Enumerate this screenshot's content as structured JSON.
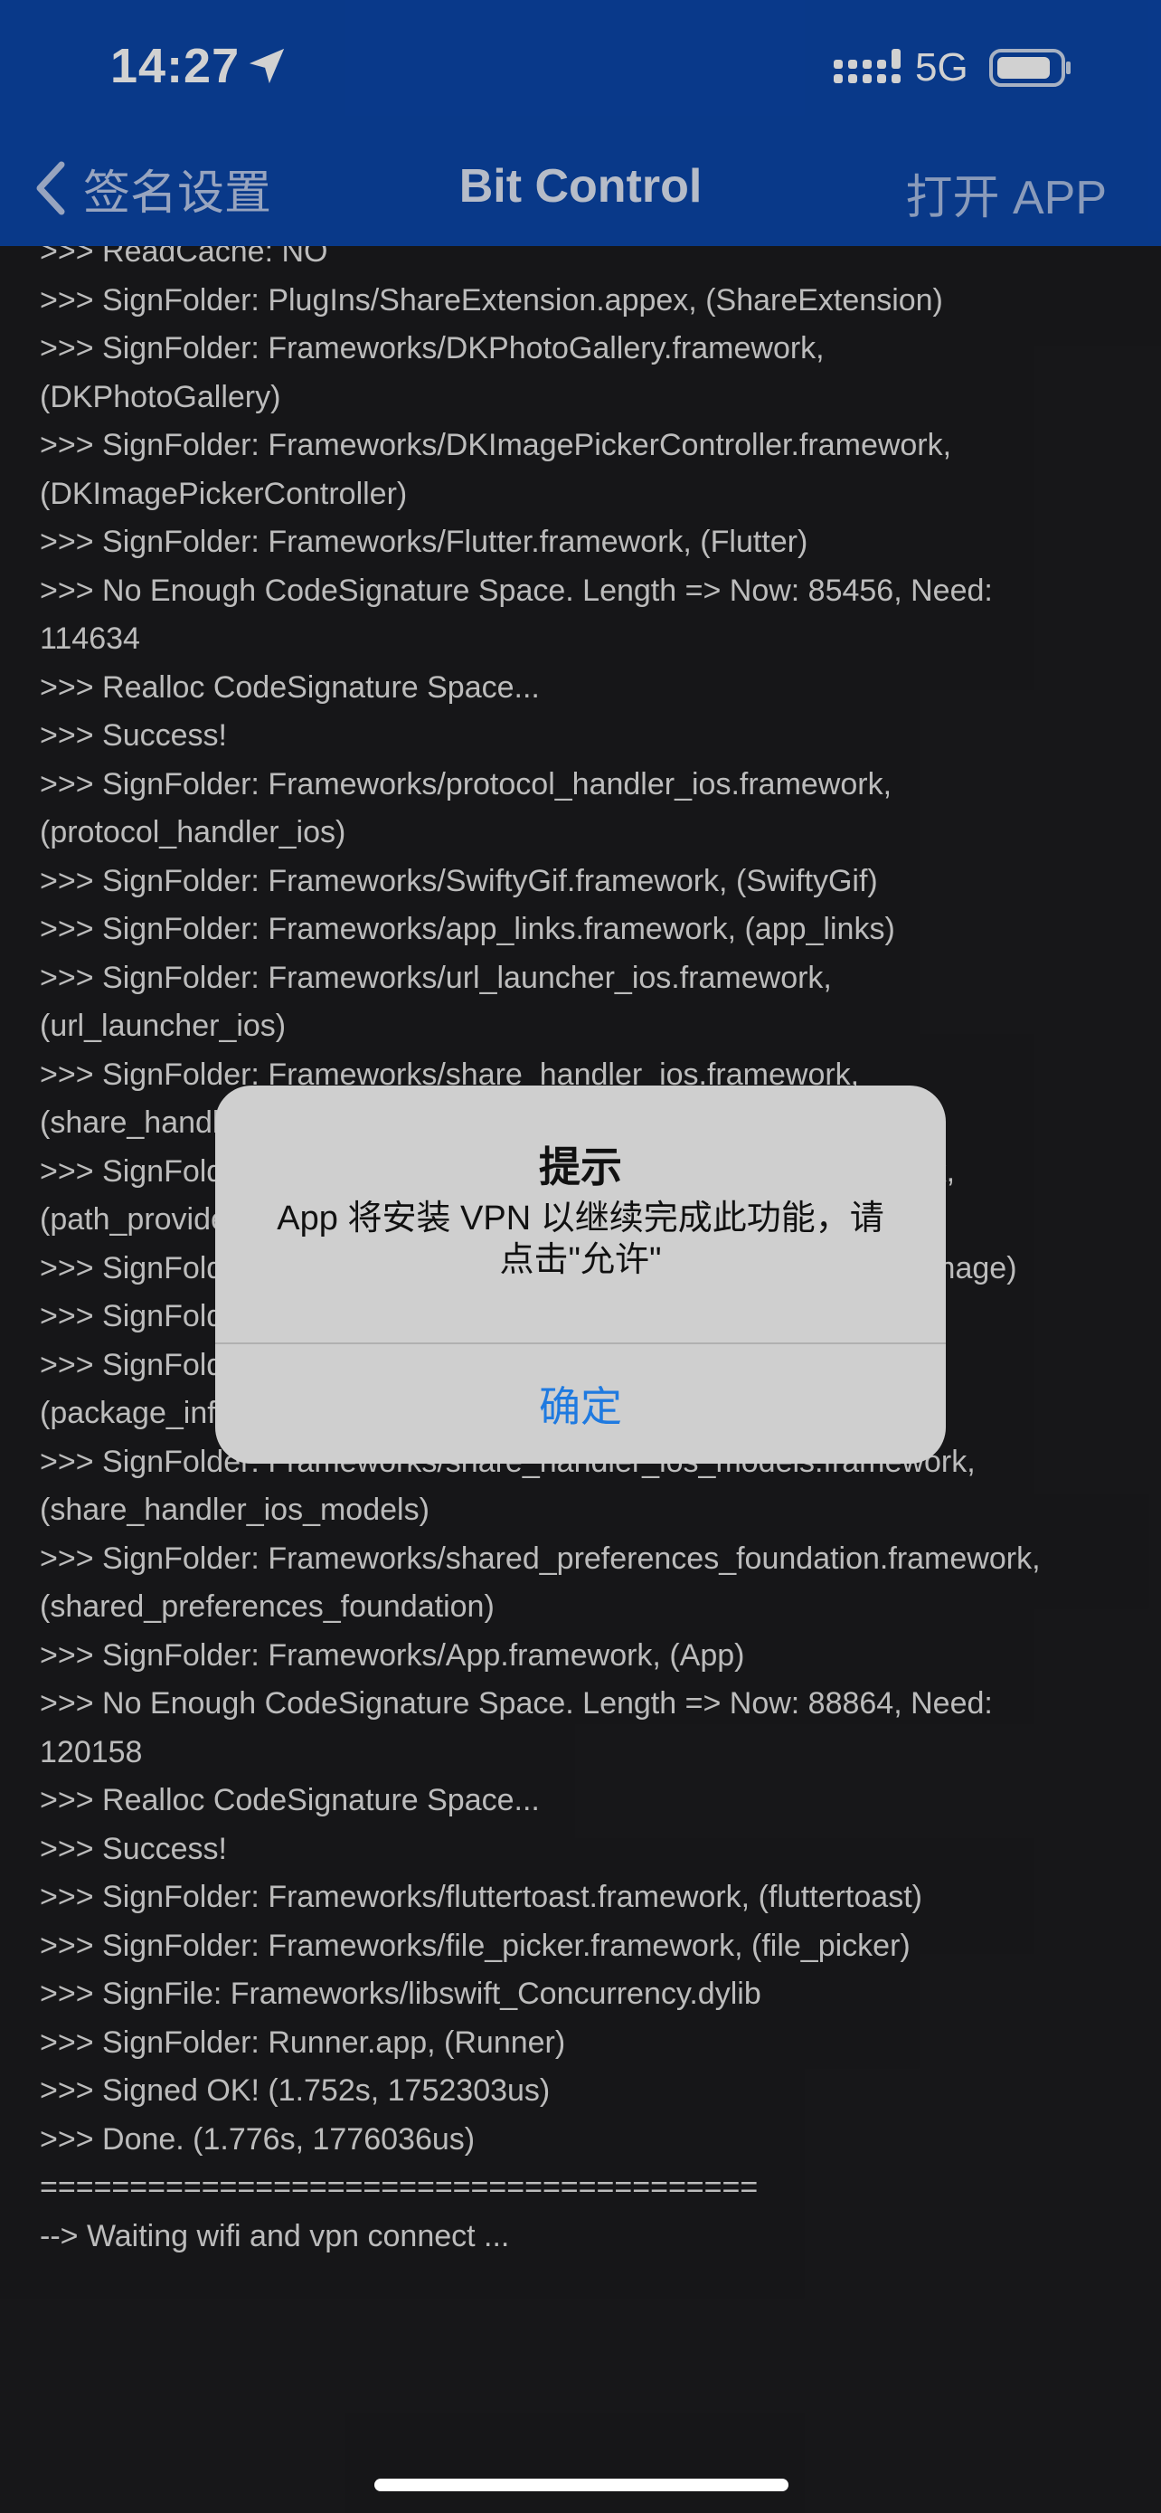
{
  "status_bar": {
    "time": "14:27",
    "network": "5G",
    "icons": [
      "location-arrow-icon",
      "signal-bars-icon",
      "battery-icon"
    ]
  },
  "nav": {
    "back_label": "签名设置",
    "title": "Bit Control",
    "action_label": "打开 APP"
  },
  "log_lines": [
    ">>> ReadCache:      NO",
    ">>> SignFolder: PlugIns/ShareExtension.appex, (ShareExtension)",
    ">>> SignFolder: Frameworks/DKPhotoGallery.framework,",
    "(DKPhotoGallery)",
    ">>> SignFolder: Frameworks/DKImagePickerController.framework,",
    "(DKImagePickerController)",
    ">>> SignFolder: Frameworks/Flutter.framework, (Flutter)",
    ">>> No Enough CodeSignature Space. Length => Now: 85456, Need:",
    "114634",
    ">>> Realloc CodeSignature Space...",
    ">>> Success!",
    ">>> SignFolder: Frameworks/protocol_handler_ios.framework,",
    "(protocol_handler_ios)",
    ">>> SignFolder: Frameworks/SwiftyGif.framework, (SwiftyGif)",
    ">>> SignFolder: Frameworks/app_links.framework, (app_links)",
    ">>> SignFolder: Frameworks/url_launcher_ios.framework,",
    "(url_launcher_ios)",
    ">>> SignFolder: Frameworks/share_handler_ios.framework,",
    "(share_handler_ios)",
    ">>> SignFolder: Frameworks/path_provider_foundation.framework,",
    "(path_provider_foundation)",
    ">>> SignFolder: Frameworks/SDWebImage.framework, (SDWebImage)",
    ">>> SignFolder: Frameworks/Toast.framework, (Toast_ios)",
    ">>> SignFolder: Frameworks/package_info_plus.framework,",
    "(package_info_plus)",
    ">>> SignFolder: Frameworks/share_handler_ios_models.framework,",
    "(share_handler_ios_models)",
    ">>> SignFolder: Frameworks/shared_preferences_foundation.framework,",
    "(shared_preferences_foundation)",
    ">>> SignFolder: Frameworks/App.framework, (App)",
    ">>> No Enough CodeSignature Space. Length => Now: 88864, Need:",
    "120158",
    ">>> Realloc CodeSignature Space...",
    ">>> Success!",
    ">>> SignFolder: Frameworks/fluttertoast.framework, (fluttertoast)",
    ">>> SignFolder: Frameworks/file_picker.framework, (file_picker)",
    ">>> SignFile:    Frameworks/libswift_Concurrency.dylib",
    ">>> SignFolder: Runner.app, (Runner)",
    ">>> Signed OK! (1.752s, 1752303us)",
    ">>> Done. (1.776s, 1776036us)",
    "========================================",
    "--> Waiting wifi and vpn connect ..."
  ],
  "dialog": {
    "title": "提示",
    "message": "App 将安装 VPN 以继续完成此功能，请点击\"允许\"",
    "confirm_label": "确定"
  },
  "colors": {
    "header_bg": "#0b46a8",
    "log_bg": "#1c1c1e",
    "dialog_bg": "#cfcfcf",
    "accent": "#1f7ae0"
  }
}
